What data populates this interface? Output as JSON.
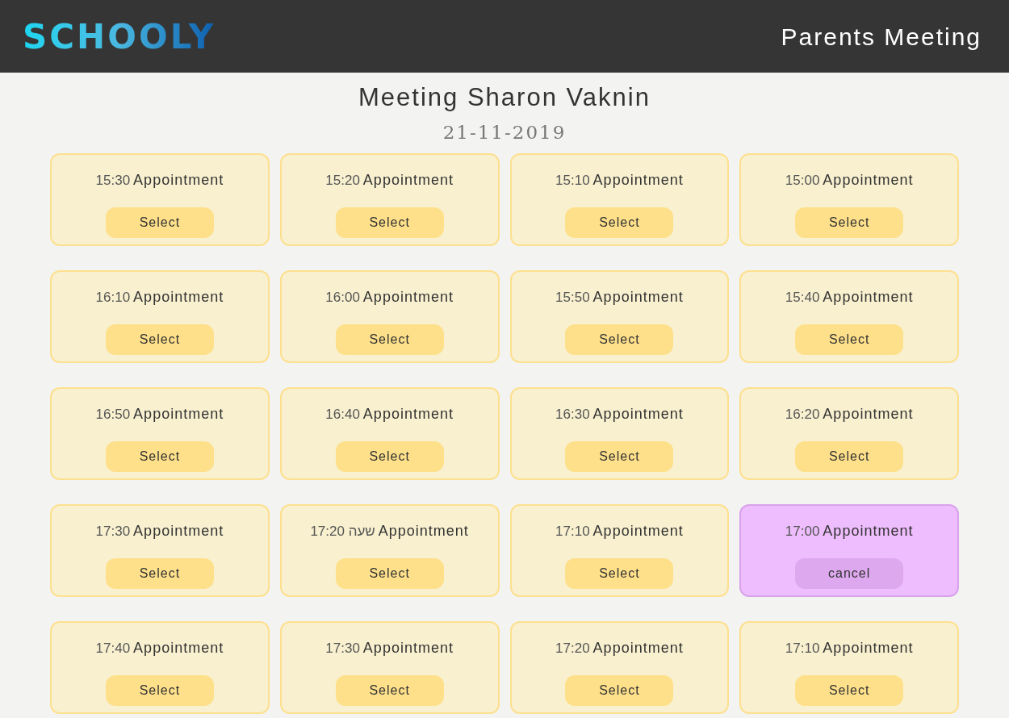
{
  "header": {
    "logo": "SCHOOLY",
    "title": "Parents Meeting"
  },
  "meeting": {
    "title": "Meeting Sharon Vaknin",
    "date": "21-11-2019"
  },
  "slots": [
    {
      "time": "15:30",
      "label": "Appointment",
      "button": "Select",
      "selected": false
    },
    {
      "time": "15:20",
      "label": "Appointment",
      "button": "Select",
      "selected": false
    },
    {
      "time": "15:10",
      "label": "Appointment",
      "button": "Select",
      "selected": false
    },
    {
      "time": "15:00",
      "label": "Appointment",
      "button": "Select",
      "selected": false
    },
    {
      "time": "16:10",
      "label": "Appointment",
      "button": "Select",
      "selected": false
    },
    {
      "time": "16:00",
      "label": "Appointment",
      "button": "Select",
      "selected": false
    },
    {
      "time": "15:50",
      "label": "Appointment",
      "button": "Select",
      "selected": false
    },
    {
      "time": "15:40",
      "label": "Appointment",
      "button": "Select",
      "selected": false
    },
    {
      "time": "16:50",
      "label": "Appointment",
      "button": "Select",
      "selected": false
    },
    {
      "time": "16:40",
      "label": "Appointment",
      "button": "Select",
      "selected": false
    },
    {
      "time": "16:30",
      "label": "Appointment",
      "button": "Select",
      "selected": false
    },
    {
      "time": "16:20",
      "label": "Appointment",
      "button": "Select",
      "selected": false
    },
    {
      "time": "17:30",
      "label": "Appointment",
      "button": "Select",
      "selected": false
    },
    {
      "time": "17:20 שעה",
      "label": "Appointment",
      "button": "Select",
      "selected": false
    },
    {
      "time": "17:10",
      "label": "Appointment",
      "button": "Select",
      "selected": false
    },
    {
      "time": "17:00",
      "label": "Appointment",
      "button": "cancel",
      "selected": true
    },
    {
      "time": "17:40",
      "label": "Appointment",
      "button": "Select",
      "selected": false
    },
    {
      "time": "17:30",
      "label": "Appointment",
      "button": "Select",
      "selected": false
    },
    {
      "time": "17:20",
      "label": "Appointment",
      "button": "Select",
      "selected": false
    },
    {
      "time": "17:10",
      "label": "Appointment",
      "button": "Select",
      "selected": false
    }
  ]
}
